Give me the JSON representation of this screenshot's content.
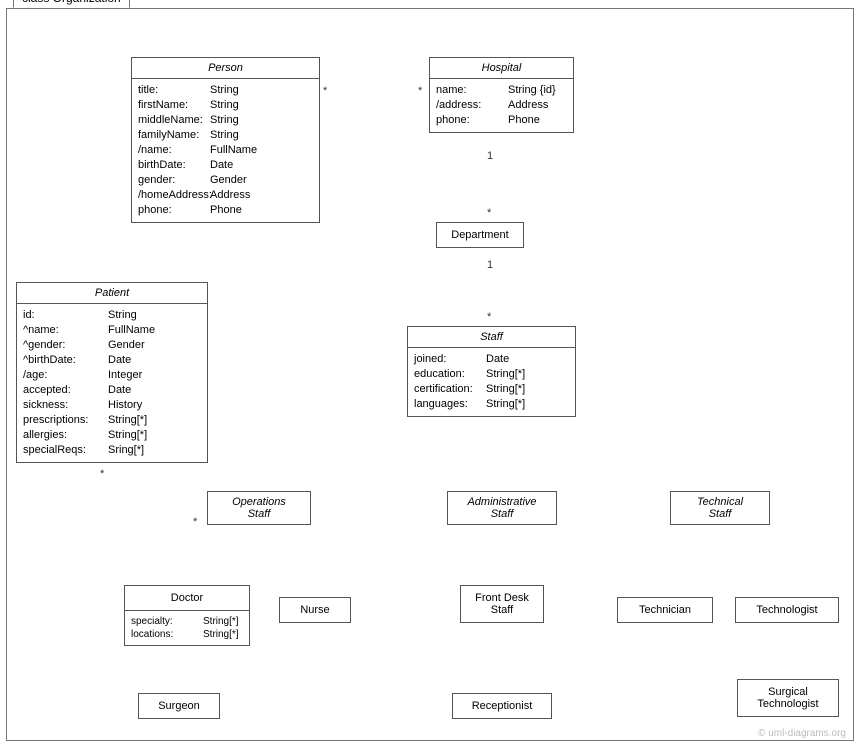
{
  "frame": {
    "label": "class Organization"
  },
  "classes": {
    "person": {
      "name": "Person",
      "attrs": [
        {
          "n": "title:",
          "t": "String"
        },
        {
          "n": "firstName:",
          "t": "String"
        },
        {
          "n": "middleName:",
          "t": "String"
        },
        {
          "n": "familyName:",
          "t": "String"
        },
        {
          "n": "/name:",
          "t": "FullName"
        },
        {
          "n": "birthDate:",
          "t": "Date"
        },
        {
          "n": "gender:",
          "t": "Gender"
        },
        {
          "n": "/homeAddress:",
          "t": "Address"
        },
        {
          "n": "phone:",
          "t": "Phone"
        }
      ]
    },
    "hospital": {
      "name": "Hospital",
      "attrs": [
        {
          "n": "name:",
          "t": "String {id}"
        },
        {
          "n": "/address:",
          "t": "Address"
        },
        {
          "n": "phone:",
          "t": "Phone"
        }
      ]
    },
    "department": {
      "name": "Department"
    },
    "patient": {
      "name": "Patient",
      "attrs": [
        {
          "n": "id:",
          "t": "String"
        },
        {
          "n": "^name:",
          "t": "FullName"
        },
        {
          "n": "^gender:",
          "t": "Gender"
        },
        {
          "n": "^birthDate:",
          "t": "Date"
        },
        {
          "n": "/age:",
          "t": "Integer"
        },
        {
          "n": "accepted:",
          "t": "Date"
        },
        {
          "n": "sickness:",
          "t": "History"
        },
        {
          "n": "prescriptions:",
          "t": "String[*]"
        },
        {
          "n": "allergies:",
          "t": "String[*]"
        },
        {
          "n": "specialReqs:",
          "t": "Sring[*]"
        }
      ]
    },
    "staff": {
      "name": "Staff",
      "attrs": [
        {
          "n": "joined:",
          "t": "Date"
        },
        {
          "n": "education:",
          "t": "String[*]"
        },
        {
          "n": "certification:",
          "t": "String[*]"
        },
        {
          "n": "languages:",
          "t": "String[*]"
        }
      ]
    },
    "opsStaff": {
      "name": "Operations",
      "name2": "Staff"
    },
    "adminStaff": {
      "name": "Administrative",
      "name2": "Staff"
    },
    "techStaff": {
      "name": "Technical",
      "name2": "Staff"
    },
    "doctor": {
      "name": "Doctor",
      "attrs": [
        {
          "n": "specialty:",
          "t": "String[*]"
        },
        {
          "n": "locations:",
          "t": "String[*]"
        }
      ]
    },
    "nurse": {
      "name": "Nurse"
    },
    "frontDesk": {
      "name": "Front Desk",
      "name2": "Staff"
    },
    "technician": {
      "name": "Technician"
    },
    "technologist": {
      "name": "Technologist"
    },
    "surgeon": {
      "name": "Surgeon"
    },
    "receptionist": {
      "name": "Receptionist"
    },
    "surgTech": {
      "name": "Surgical",
      "name2": "Technologist"
    }
  },
  "mult": {
    "personHospL": "*",
    "personHospR": "*",
    "hospDeptTop": "1",
    "hospDeptBot": "*",
    "deptStaffTop": "1",
    "deptStaffBot": "*",
    "patientOpsL": "*",
    "patientOpsR": "*"
  },
  "watermark": "© uml-diagrams.org"
}
